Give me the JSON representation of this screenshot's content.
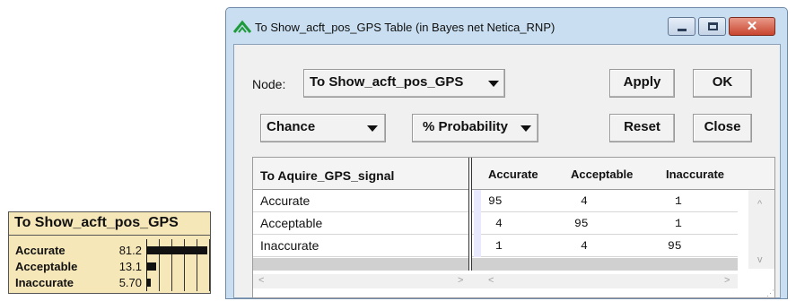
{
  "node_box": {
    "title": "To Show_acft_pos_GPS",
    "states": [
      {
        "label": "Accurate",
        "value": "81.2",
        "probability": 0.812
      },
      {
        "label": "Acceptable",
        "value": "13.1",
        "probability": 0.131
      },
      {
        "label": "Inaccurate",
        "value": "5.70",
        "probability": 0.057
      }
    ]
  },
  "window": {
    "title": "To Show_acft_pos_GPS  Table (in Bayes net Netica_RNP)",
    "app_icon": "netica-icon",
    "controls": {
      "minimize": "minimize-icon",
      "maximize": "maximize-icon",
      "close": "✕"
    }
  },
  "toolbar": {
    "node_label": "Node:",
    "node_value": "To Show_acft_pos_GPS",
    "node_type": "Chance",
    "display_mode": "% Probability",
    "apply": "Apply",
    "ok": "OK",
    "reset": "Reset",
    "close": "Close"
  },
  "table": {
    "parent_header": "To Aquire_GPS_signal",
    "columns": [
      "Accurate",
      "Acceptable",
      "Inaccurate"
    ],
    "rows": [
      {
        "label": "Accurate",
        "values": [
          "95",
          "4",
          "1"
        ]
      },
      {
        "label": "Acceptable",
        "values": [
          "4",
          "95",
          "1"
        ]
      },
      {
        "label": "Inaccurate",
        "values": [
          "1",
          "4",
          "95"
        ]
      }
    ],
    "scroll_arrows": {
      "up": "^",
      "down": "v",
      "left": "<",
      "right": ">"
    }
  }
}
